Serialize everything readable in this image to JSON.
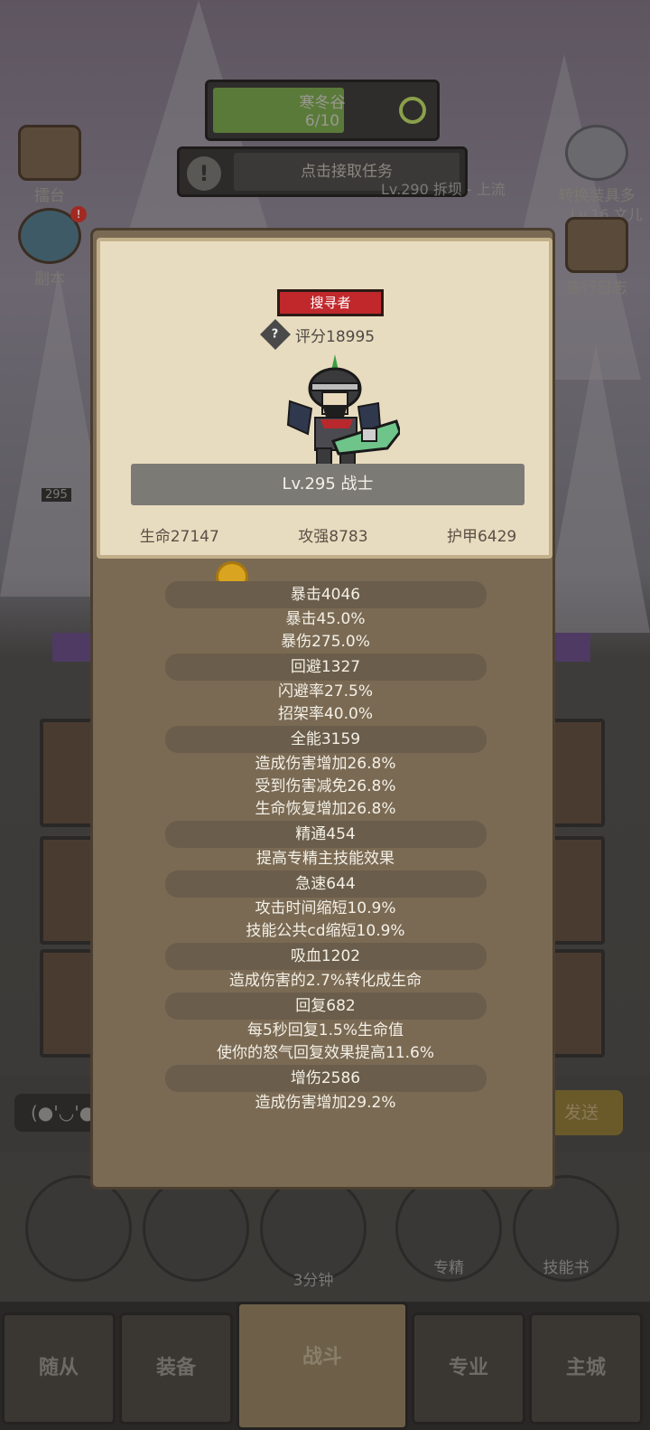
{
  "quest": {
    "title": "寒冬谷",
    "progress": "6/10",
    "progress_fraction": 0.6,
    "task_button": "点击接取任务",
    "side_caption": "Lv.290 拆坝 - 上流"
  },
  "left_buttons": [
    {
      "label": "擂台",
      "icon": "notice-board-icon"
    },
    {
      "label": "副本",
      "icon": "portal-icon"
    }
  ],
  "right_buttons": [
    {
      "label": "转换装具多",
      "icon": "gear-icon"
    },
    {
      "label": "旅行日志",
      "icon": "journal-icon"
    }
  ],
  "right_caption": "Lv.16 文儿",
  "left_level_badge": "295",
  "chat": {
    "input": "(●'◡'●)",
    "send": "发送"
  },
  "circle_buttons": [
    {
      "label": "",
      "icon": "potion-icon"
    },
    {
      "label": "",
      "icon": "bread-icon"
    },
    {
      "label": "3分钟",
      "icon": "chest-icon"
    },
    {
      "label": "专精",
      "icon": "specialty-icon"
    },
    {
      "label": "技能书",
      "icon": "skill-book-icon"
    }
  ],
  "bottom_nav": [
    "随从",
    "装备",
    "战斗",
    "专业",
    "主城"
  ],
  "profile": {
    "badge": "搜寻者",
    "score": "评分18995",
    "level": "Lv.295 战士",
    "stats": [
      "生命27147",
      "攻强8783",
      "护甲6429"
    ]
  },
  "secondary_stats": [
    {
      "header": "暴击4046",
      "lines": [
        "暴击45.0%",
        "暴伤275.0%"
      ]
    },
    {
      "header": "回避1327",
      "lines": [
        "闪避率27.5%",
        "招架率40.0%"
      ]
    },
    {
      "header": "全能3159",
      "lines": [
        "造成伤害增加26.8%",
        "受到伤害减免26.8%",
        "生命恢复增加26.8%"
      ]
    },
    {
      "header": "精通454",
      "lines": [
        "提高专精主技能效果"
      ]
    },
    {
      "header": "急速644",
      "lines": [
        "攻击时间缩短10.9%",
        "技能公共cd缩短10.9%"
      ]
    },
    {
      "header": "吸血1202",
      "lines": [
        "造成伤害的2.7%转化成生命"
      ]
    },
    {
      "header": "回复682",
      "lines": [
        "每5秒回复1.5%生命值",
        "使你的怒气回复效果提高11.6%"
      ]
    },
    {
      "header": "增伤2586",
      "lines": [
        "造成伤害增加29.2%"
      ]
    }
  ],
  "colors": {
    "badge_red": "#c0282c",
    "card_bg": "#e8dcc0",
    "panel_bg": "#7a6a54"
  }
}
